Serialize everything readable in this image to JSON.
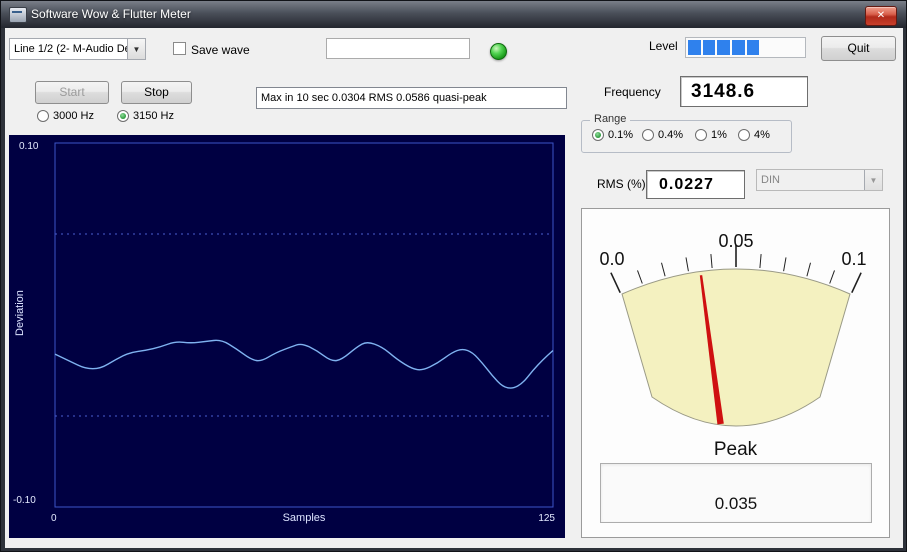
{
  "window": {
    "title": "Software Wow & Flutter Meter",
    "close_glyph": "✕"
  },
  "toolbar": {
    "device_value": "Line 1/2 (2- M-Audio De",
    "save_wave_label": "Save wave",
    "filename_value": "",
    "level_label": "Level",
    "level_meter": {
      "filled": 5,
      "total": 8
    },
    "quit_label": "Quit"
  },
  "transport": {
    "start_label": "Start",
    "stop_label": "Stop"
  },
  "freq_radios": [
    {
      "label": "3000 Hz",
      "selected": false
    },
    {
      "label": "3150 Hz",
      "selected": true
    }
  ],
  "status_text": "Max in 10 sec 0.0304 RMS 0.0586 quasi-peak",
  "frequency": {
    "label": "Frequency",
    "value": "3148.6"
  },
  "range": {
    "label": "Range",
    "options": [
      {
        "label": "0.1%",
        "selected": true
      },
      {
        "label": "0.4%",
        "selected": false
      },
      {
        "label": "1%",
        "selected": false
      },
      {
        "label": "4%",
        "selected": false
      }
    ]
  },
  "rms": {
    "label": "RMS (%)",
    "value": "0.0227"
  },
  "weighting": {
    "value": "DIN"
  },
  "chart_data": {
    "type": "line",
    "title": "",
    "xlabel": "Samples",
    "ylabel": "Deviation",
    "xlim": [
      0,
      125
    ],
    "ylim": [
      -0.1,
      0.1
    ],
    "y_tick_labels": [
      "0.10",
      "-0.10"
    ],
    "x_tick_labels": [
      "0",
      "125"
    ],
    "gridlines_y": [
      0.05,
      -0.05
    ],
    "x": [
      0,
      3.8,
      7.6,
      11.4,
      15.2,
      18.9,
      22.7,
      26.5,
      30.3,
      34.1,
      37.9,
      41.7,
      45.5,
      49.2,
      51.8,
      55.6,
      59.3,
      61.9,
      65.7,
      69.4,
      72,
      75.8,
      78.3,
      82.1,
      85.9,
      89.6,
      92.2,
      96,
      99.7,
      102.3,
      104.8,
      107.3,
      109.8,
      112.4,
      114.9,
      117.4,
      119.9,
      122.5,
      125
    ],
    "y": [
      -0.016,
      -0.02,
      -0.024,
      -0.024,
      -0.019,
      -0.015,
      -0.014,
      -0.012,
      -0.009,
      -0.01,
      -0.009,
      -0.008,
      -0.013,
      -0.019,
      -0.02,
      -0.015,
      -0.012,
      -0.01,
      -0.014,
      -0.02,
      -0.019,
      -0.012,
      -0.009,
      -0.012,
      -0.019,
      -0.024,
      -0.025,
      -0.021,
      -0.015,
      -0.013,
      -0.015,
      -0.021,
      -0.028,
      -0.034,
      -0.035,
      -0.032,
      -0.025,
      -0.019,
      -0.014
    ]
  },
  "meter": {
    "scale_labels": [
      "0.0",
      "0.05",
      "0.1"
    ],
    "min": 0,
    "max": 0.1,
    "sweep_deg": 50,
    "needle_value": 0.035,
    "peak_label": "Peak",
    "peak_value": "0.035"
  },
  "colors": {
    "level_fill": "#2f81ed",
    "led_green": "#2fbb2f",
    "chart_bg": "#000042",
    "trace": "#7fb2f0",
    "grid": "#4a5ed0",
    "meter_face": "#f4f1c0",
    "needle": "#cf1010"
  }
}
